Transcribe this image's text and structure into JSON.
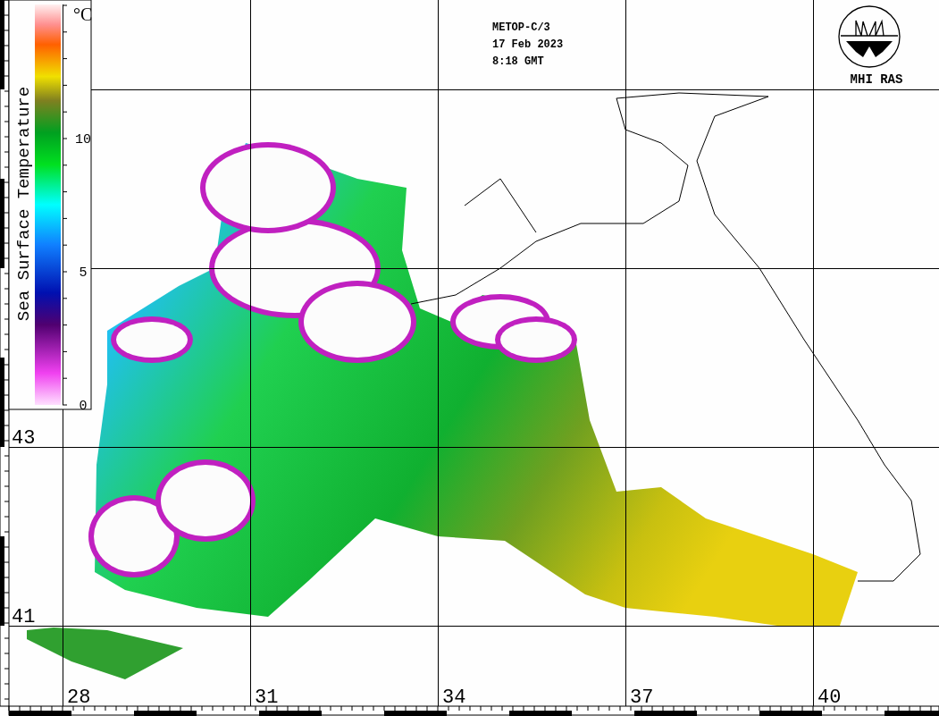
{
  "header": {
    "lines": [
      "METOP-C/3",
      "17 Feb 2023",
      "8:18 GMT"
    ]
  },
  "logo": {
    "label": "MHI RAS"
  },
  "legend": {
    "title": "Sea Surface Temperature",
    "unit": "°C",
    "ticks": [
      "10",
      "5",
      "0"
    ]
  },
  "latitude_labels": [
    "43",
    "41"
  ],
  "longitude_labels": [
    "28",
    "31",
    "34",
    "37",
    "40"
  ]
}
